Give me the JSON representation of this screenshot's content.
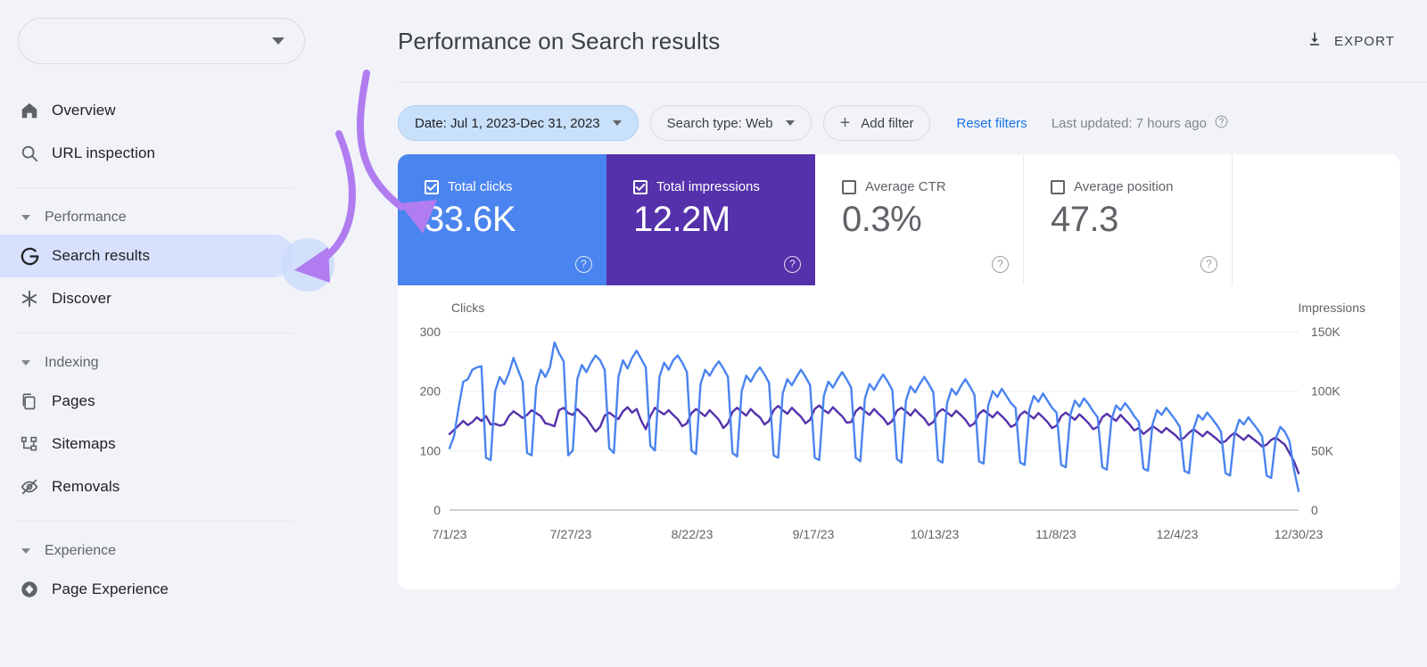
{
  "sidebar": {
    "site_selector": {
      "value": "",
      "icon": "chevron-down-icon"
    },
    "items": [
      {
        "label": "Overview",
        "icon": "home-icon",
        "active": false
      },
      {
        "label": "URL inspection",
        "icon": "search-icon",
        "active": false
      }
    ],
    "groups": [
      {
        "label": "Performance",
        "items": [
          {
            "label": "Search results",
            "icon": "google-g-icon",
            "active": true
          },
          {
            "label": "Discover",
            "icon": "asterisk-icon",
            "active": false
          }
        ]
      },
      {
        "label": "Indexing",
        "items": [
          {
            "label": "Pages",
            "icon": "pages-icon",
            "active": false
          },
          {
            "label": "Sitemaps",
            "icon": "sitemap-icon",
            "active": false
          },
          {
            "label": "Removals",
            "icon": "eye-off-icon",
            "active": false
          }
        ]
      },
      {
        "label": "Experience",
        "items": [
          {
            "label": "Page Experience",
            "icon": "page-experience-icon",
            "active": false
          }
        ]
      }
    ]
  },
  "header": {
    "title": "Performance on Search results",
    "export_label": "EXPORT",
    "export_icon": "download-icon"
  },
  "filters": {
    "date_chip": {
      "label": "Date: Jul 1, 2023-Dec 31, 2023",
      "selected": true,
      "icon": "chevron-down-icon"
    },
    "search_type_chip": {
      "label": "Search type: Web",
      "selected": false,
      "icon": "chevron-down-icon"
    },
    "add_filter_chip": {
      "label": "Add filter",
      "icon": "plus-icon"
    },
    "reset_link": "Reset filters",
    "last_updated": "Last updated: 7 hours ago",
    "last_updated_help_icon": "help-circle-icon"
  },
  "metrics": [
    {
      "label": "Total clicks",
      "value": "33.6K",
      "checked": true,
      "style": "clicks",
      "help_icon": "help-circle-icon"
    },
    {
      "label": "Total impressions",
      "value": "12.2M",
      "checked": true,
      "style": "impressions",
      "help_icon": "help-circle-icon"
    },
    {
      "label": "Average CTR",
      "value": "0.3%",
      "checked": false,
      "style": "plain",
      "help_icon": "help-circle-icon"
    },
    {
      "label": "Average position",
      "value": "47.3",
      "checked": false,
      "style": "plain",
      "help_icon": "help-circle-icon"
    }
  ],
  "colors": {
    "clicks": "#5531ab",
    "impressions": "#4a84ef",
    "clicks_card": "#4a84ef",
    "impressions_card": "#5531ab",
    "accent_link": "#1a73e8",
    "sidebar_active": "#d7e0fd",
    "annotation_purple": "#b07cf0",
    "chip_selected": "#c9e0fb"
  },
  "chart_data": {
    "type": "line",
    "title": "",
    "left_axis": {
      "label": "Clicks",
      "ticks": [
        "0",
        "100",
        "200",
        "300"
      ],
      "min": 0,
      "max": 300
    },
    "right_axis": {
      "label": "Impressions",
      "ticks": [
        "0",
        "50K",
        "100K",
        "150K"
      ],
      "min": 0,
      "max": 150000
    },
    "grid": true,
    "legend_position": "none",
    "x_tick_labels": [
      "7/1/23",
      "7/27/23",
      "8/22/23",
      "9/17/23",
      "10/13/23",
      "11/8/23",
      "12/4/23",
      "12/30/23"
    ],
    "x_start": "7/1/23",
    "x_end": "12/30/23",
    "n_points": 184,
    "series": [
      {
        "name": "Clicks",
        "axis": "left",
        "color": "#5531ab",
        "values": [
          128,
          135,
          142,
          150,
          143,
          148,
          156,
          150,
          158,
          144,
          145,
          142,
          144,
          158,
          166,
          161,
          155,
          160,
          168,
          163,
          158,
          146,
          144,
          141,
          168,
          172,
          163,
          160,
          170,
          162,
          155,
          143,
          132,
          140,
          159,
          164,
          158,
          153,
          166,
          173,
          164,
          170,
          150,
          136,
          158,
          172,
          166,
          161,
          168,
          160,
          153,
          141,
          146,
          163,
          170,
          164,
          158,
          168,
          160,
          152,
          138,
          146,
          165,
          172,
          165,
          159,
          170,
          162,
          156,
          144,
          150,
          168,
          175,
          168,
          162,
          172,
          164,
          157,
          146,
          152,
          170,
          176,
          168,
          163,
          173,
          165,
          158,
          147,
          148,
          166,
          173,
          166,
          160,
          170,
          162,
          155,
          144,
          150,
          167,
          172,
          166,
          159,
          169,
          161,
          154,
          143,
          148,
          164,
          170,
          164,
          158,
          167,
          160,
          152,
          141,
          146,
          162,
          168,
          162,
          156,
          165,
          158,
          150,
          140,
          144,
          160,
          166,
          160,
          154,
          163,
          156,
          148,
          138,
          142,
          158,
          164,
          158,
          152,
          161,
          154,
          146,
          136,
          140,
          156,
          162,
          156,
          150,
          160,
          152,
          144,
          134,
          138,
          128,
          134,
          141,
          136,
          130,
          138,
          132,
          126,
          118,
          122,
          130,
          136,
          130,
          124,
          132,
          126,
          120,
          113,
          116,
          124,
          130,
          124,
          118,
          126,
          120,
          114,
          107,
          110,
          118,
          122,
          116,
          110,
          96,
          82,
          62
        ]
      },
      {
        "name": "Impressions",
        "axis": "right",
        "color": "#4a84ef",
        "values": [
          52000,
          62000,
          86000,
          108000,
          110000,
          118000,
          120000,
          121000,
          44000,
          42000,
          100000,
          112000,
          106000,
          115000,
          128000,
          118000,
          108000,
          48000,
          46000,
          104000,
          118000,
          112000,
          120000,
          141000,
          132000,
          125000,
          46000,
          50000,
          110000,
          122000,
          116000,
          124000,
          130000,
          126000,
          118000,
          52000,
          48000,
          112000,
          126000,
          119000,
          128000,
          134000,
          127000,
          120000,
          54000,
          50000,
          112000,
          124000,
          118000,
          126000,
          130000,
          124000,
          116000,
          50000,
          47000,
          106000,
          118000,
          113000,
          120000,
          125000,
          119000,
          112000,
          48000,
          45000,
          100000,
          113000,
          108000,
          115000,
          120000,
          114000,
          107000,
          46000,
          44000,
          98000,
          110000,
          105000,
          112000,
          118000,
          112000,
          105000,
          44000,
          42000,
          96000,
          108000,
          103000,
          110000,
          116000,
          110000,
          103000,
          44000,
          41000,
          94000,
          106000,
          101000,
          108000,
          114000,
          108000,
          101000,
          43000,
          40000,
          92000,
          104000,
          99000,
          106000,
          112000,
          106000,
          99000,
          42000,
          40000,
          90000,
          102000,
          97000,
          104000,
          110000,
          104000,
          97000,
          41000,
          39000,
          88000,
          100000,
          95000,
          102000,
          96000,
          90000,
          86000,
          40000,
          38000,
          84000,
          96000,
          91000,
          98000,
          92000,
          86000,
          82000,
          38000,
          36000,
          80000,
          92000,
          87000,
          94000,
          89000,
          83000,
          78000,
          36000,
          34000,
          76000,
          88000,
          84000,
          90000,
          85000,
          79000,
          74000,
          35000,
          33000,
          72000,
          84000,
          80000,
          86000,
          81000,
          76000,
          70000,
          33000,
          31000,
          68000,
          80000,
          76000,
          82000,
          77000,
          72000,
          66000,
          31000,
          29000,
          64000,
          76000,
          72000,
          78000,
          73000,
          68000,
          62000,
          29000,
          27000,
          60000,
          70000,
          66000,
          58000,
          34000,
          16000
        ]
      }
    ]
  }
}
